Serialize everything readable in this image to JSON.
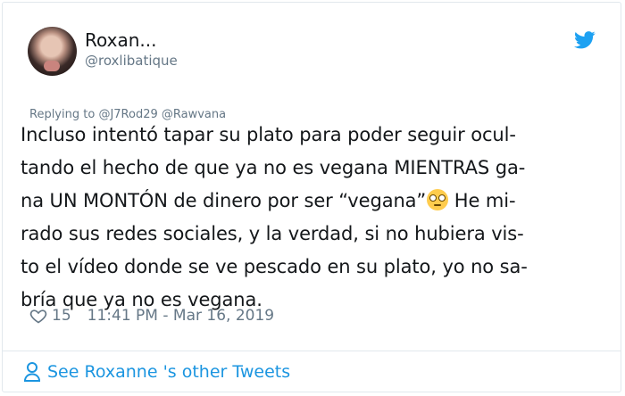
{
  "user": {
    "name": "Roxan...",
    "handle": "@roxlibatique"
  },
  "reply": {
    "prefix": "Replying to",
    "mentions": [
      "@J7Rod29",
      "@Rawvana"
    ]
  },
  "tweet": {
    "lines": [
      "Incluso intentó tapar su plato para poder seguir ocul-",
      "tando el hecho de que ya no es vegana MIENTRAS ga-",
      "na UN MONTÓN de dinero por ser “vegana”",
      " He mi-",
      "rado sus redes sociales, y la verdad, si no hubiera vis-",
      "to el vídeo donde se ve pescado en su plato, yo no sa-",
      "bría que ya no es vegana."
    ],
    "emoji": "face-with-rolling-eyes"
  },
  "meta": {
    "likes": "15",
    "timestamp": "11:41 PM - Mar 16, 2019"
  },
  "footer": {
    "label": "See Roxanne 's other Tweets"
  },
  "colors": {
    "twitter_blue": "#1da1f2",
    "link_blue": "#1b95e0",
    "muted": "#657786",
    "border": "#e1e8ed"
  },
  "icons": [
    "twitter-bird-icon",
    "heart-icon",
    "person-icon"
  ]
}
